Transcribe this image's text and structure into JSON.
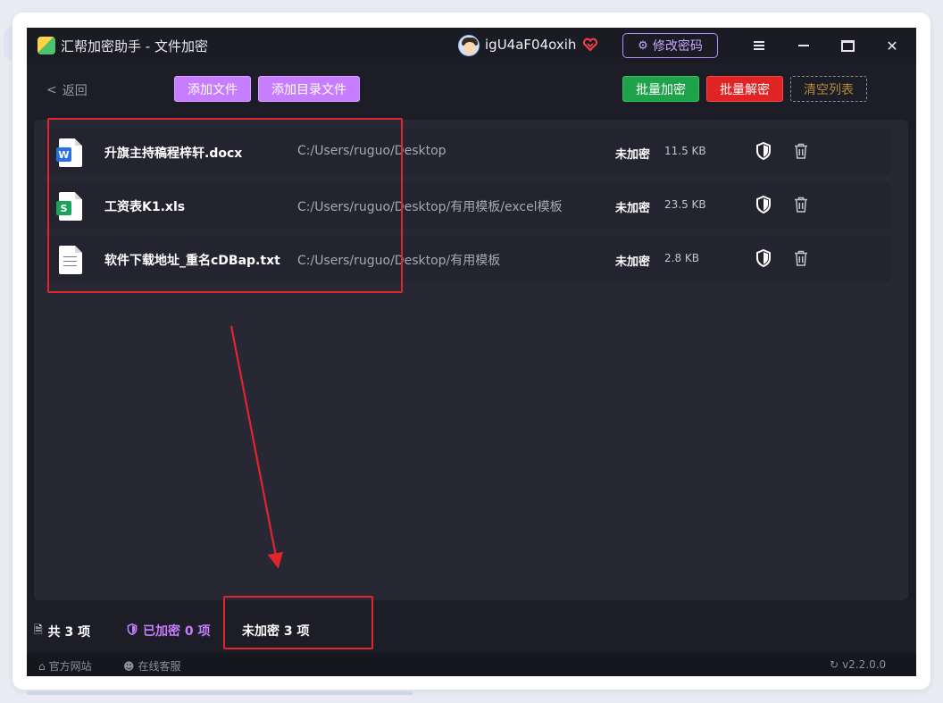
{
  "window": {
    "title": "汇帮加密助手 - 文件加密",
    "username": "igU4aF04oxih",
    "change_password": "修改密码"
  },
  "toolbar": {
    "back": "返回",
    "add_file": "添加文件",
    "add_directory": "添加目录文件",
    "batch_encrypt": "批量加密",
    "batch_decrypt": "批量解密",
    "clear_list": "清空列表"
  },
  "files": [
    {
      "name": "升旗主持稿程梓轩.docx",
      "path": "C:/Users/ruguo/Desktop",
      "status": "未加密",
      "size": "11.5 KB",
      "type": "docx",
      "icon": "word-file-icon"
    },
    {
      "name": "工资表K1.xls",
      "path": "C:/Users/ruguo/Desktop/有用模板/excel模板",
      "status": "未加密",
      "size": "23.5 KB",
      "type": "xls",
      "icon": "excel-file-icon"
    },
    {
      "name": "软件下载地址_重名cDBap.txt",
      "path": "C:/Users/ruguo/Desktop/有用模板",
      "status": "未加密",
      "size": "2.8 KB",
      "type": "txt",
      "icon": "text-file-icon"
    }
  ],
  "status": {
    "total": "共 3 项",
    "encrypted": "已加密 0 项",
    "unencrypted": "未加密 3 项"
  },
  "footer": {
    "website": "官方网站",
    "support": "在线客服",
    "version": "v2.2.0.0"
  },
  "colors": {
    "accent_purple": "#c77dff",
    "encrypt_green": "#1fa34a",
    "decrypt_red": "#e02424",
    "annotation_red": "#e0262b",
    "background": "#1c1d26"
  }
}
